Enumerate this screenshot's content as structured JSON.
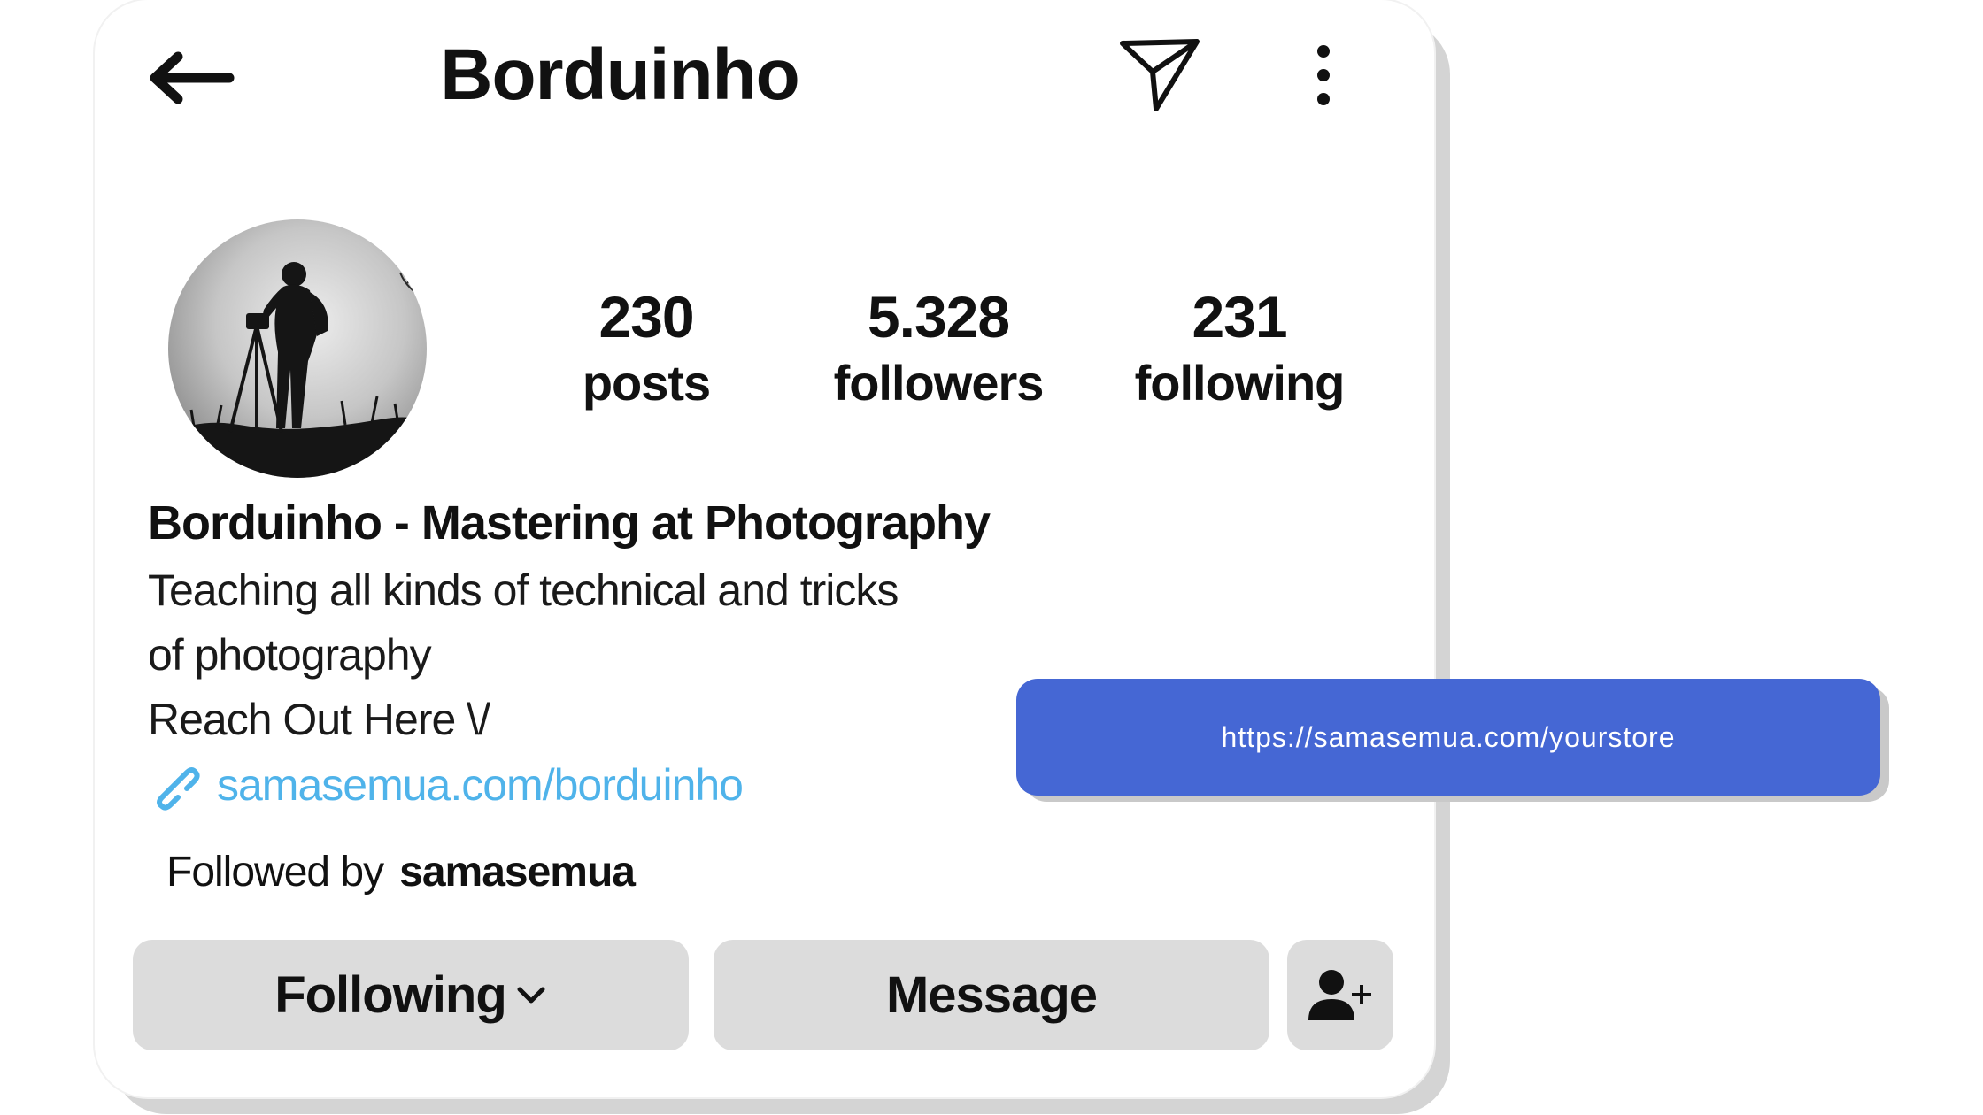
{
  "header": {
    "title": "Borduinho",
    "back_icon": "arrow-left-icon",
    "send_icon": "paper-plane-icon",
    "more_icon": "more-vertical-icon"
  },
  "stats": [
    {
      "value": "230",
      "label": "posts"
    },
    {
      "value": "5.328",
      "label": "followers"
    },
    {
      "value": "231",
      "label": "following"
    }
  ],
  "profile": {
    "name": "Borduinho - Mastering at Photography",
    "bio_lines": [
      "Teaching all kinds of technical and tricks",
      "of photography",
      "Reach Out Here \\/"
    ],
    "link_text": "samasemua.com/borduinho",
    "link_icon": "link-icon",
    "followed_by_label": "Followed by",
    "followed_by_user": "samasemua"
  },
  "actions": {
    "following_label": "Following",
    "message_label": "Message",
    "add_user_icon": "add-user-icon"
  },
  "url_overlay": {
    "text": "https://samasemua.com/yourstore"
  },
  "colors": {
    "link": "#4fb3ea",
    "overlay": "#4567d4",
    "button": "#dcdcdc",
    "card_shadow": "#d4d4d4"
  }
}
